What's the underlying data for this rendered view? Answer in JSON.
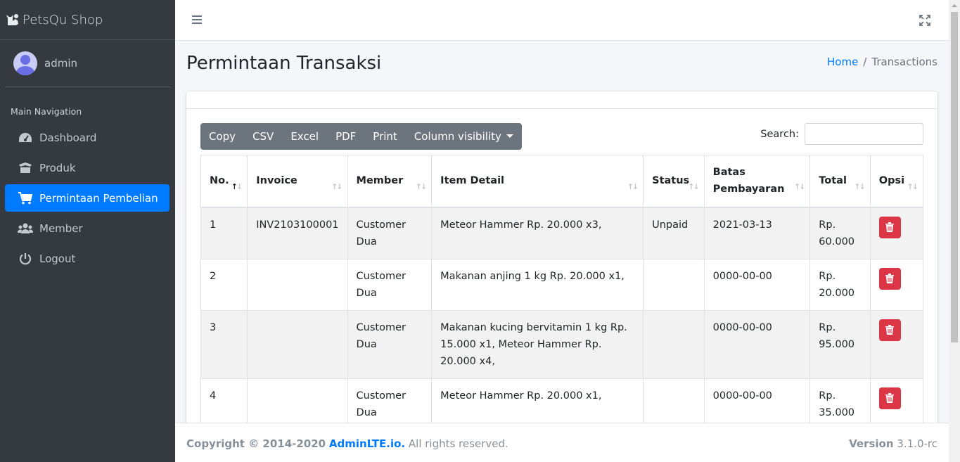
{
  "brand": {
    "name": "PetsQu Shop"
  },
  "user": {
    "name": "admin"
  },
  "nav": {
    "header": "Main Navigation",
    "items": [
      {
        "label": "Dashboard",
        "icon": "tachometer-icon"
      },
      {
        "label": "Produk",
        "icon": "box-open-icon"
      },
      {
        "label": "Permintaan Pembelian",
        "icon": "shopping-cart-icon",
        "active": true
      },
      {
        "label": "Member",
        "icon": "users-icon"
      },
      {
        "label": "Logout",
        "icon": "power-off-icon"
      }
    ]
  },
  "page": {
    "title": "Permintaan Transaksi",
    "breadcrumb": {
      "home": "Home",
      "current": "Transactions"
    }
  },
  "toolbar": {
    "buttons": [
      "Copy",
      "CSV",
      "Excel",
      "PDF",
      "Print",
      "Column visibility"
    ],
    "search_label": "Search:",
    "search_value": ""
  },
  "table": {
    "columns": [
      "No.",
      "Invoice",
      "Member",
      "Item Detail",
      "Status",
      "Batas Pembayaran",
      "Total",
      "Opsi"
    ],
    "rows": [
      {
        "no": "1",
        "invoice": "INV2103100001",
        "member": "Customer Dua",
        "item": "Meteor Hammer Rp. 20.000 x3,",
        "status": "Unpaid",
        "deadline": "2021-03-13",
        "total": "Rp. 60.000"
      },
      {
        "no": "2",
        "invoice": "",
        "member": "Customer Dua",
        "item": "Makanan anjing 1 kg Rp. 20.000 x1,",
        "status": "",
        "deadline": "0000-00-00",
        "total": "Rp. 20.000"
      },
      {
        "no": "3",
        "invoice": "",
        "member": "Customer Dua",
        "item": "Makanan kucing bervitamin 1 kg Rp. 15.000 x1, Meteor Hammer Rp. 20.000 x4,",
        "status": "",
        "deadline": "0000-00-00",
        "total": "Rp. 95.000"
      },
      {
        "no": "4",
        "invoice": "",
        "member": "Customer Dua",
        "item": "Meteor Hammer Rp. 20.000 x1,",
        "status": "",
        "deadline": "0000-00-00",
        "total": "Rp. 35.000"
      }
    ]
  },
  "footer": {
    "copyright": "Copyright © 2014-2020",
    "link": "AdminLTE.io.",
    "rights": "All rights reserved.",
    "version_label": "Version",
    "version": "3.1.0-rc"
  },
  "colors": {
    "sidebar": "#343a40",
    "accent": "#007bff",
    "danger": "#dc3545",
    "toolbar": "#6c757d"
  }
}
